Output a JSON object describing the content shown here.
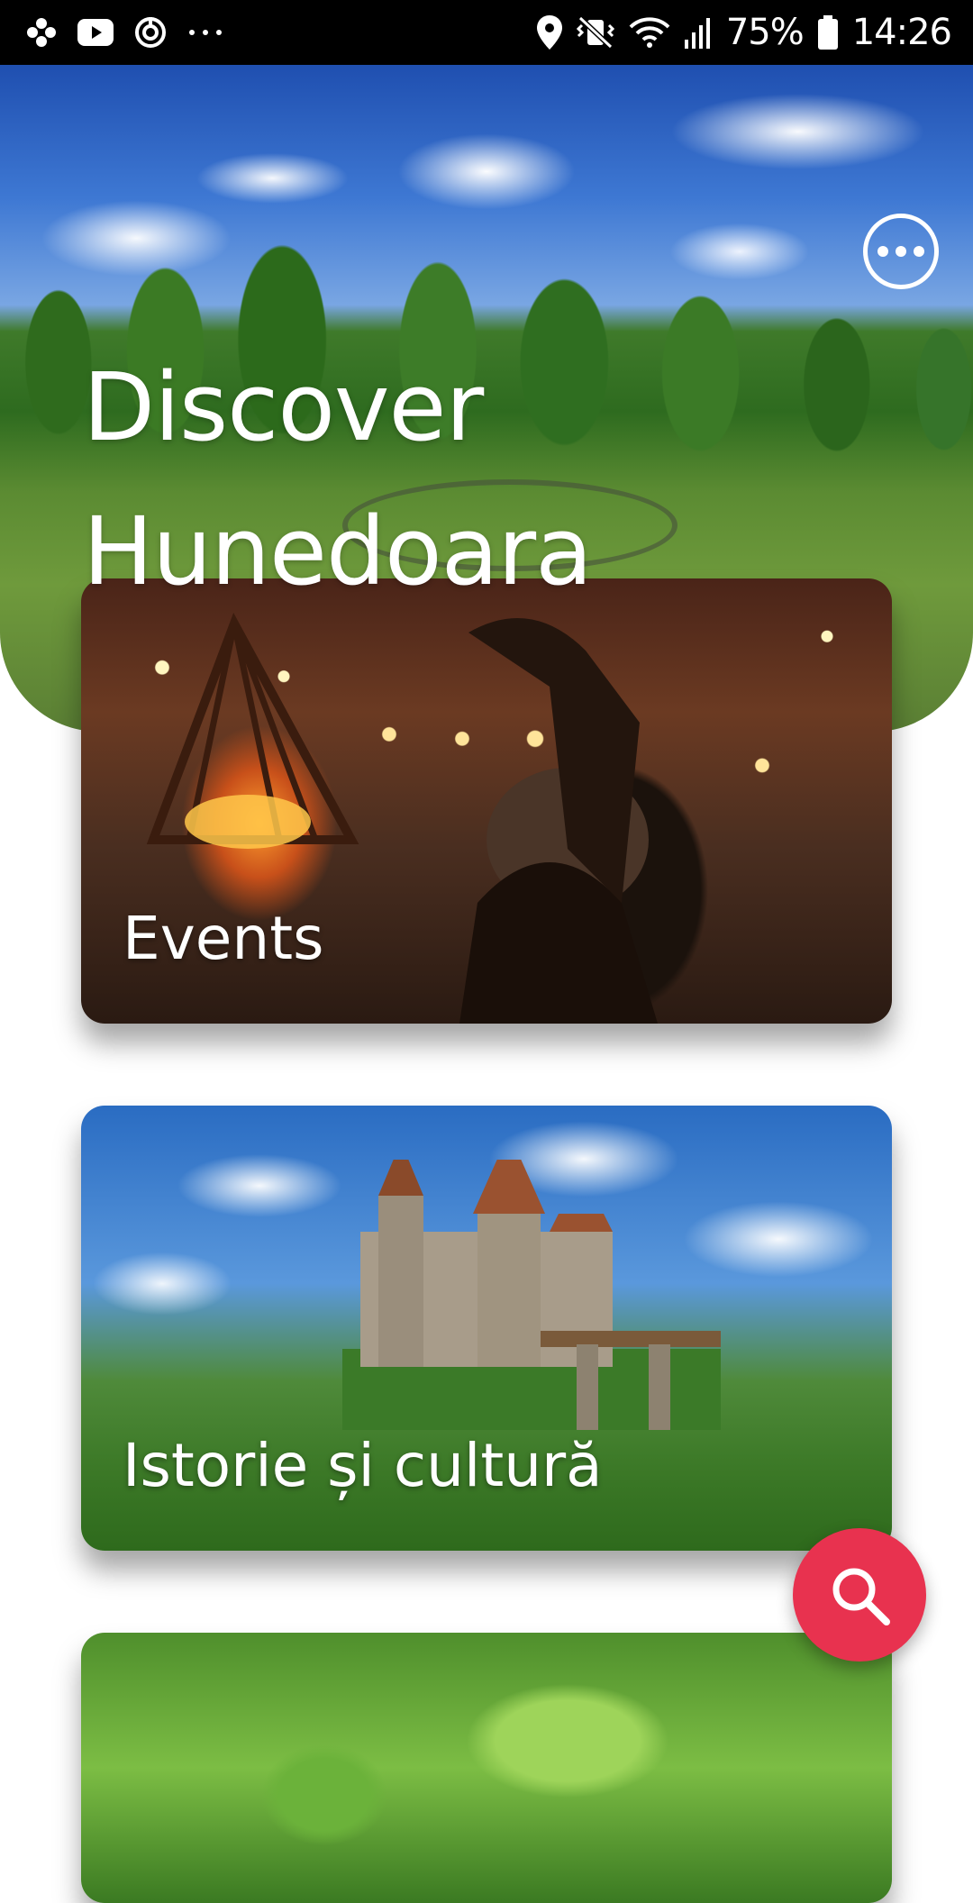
{
  "status_bar": {
    "battery": "75%",
    "time": "14:26",
    "left_icons": [
      "pinwheel-icon",
      "youtube-icon",
      "sync-icon",
      "more-dots-icon"
    ],
    "right_icons": [
      "location-icon",
      "vibrate-icon",
      "wifi-icon",
      "signal-icon",
      "battery-icon"
    ]
  },
  "hero": {
    "title_line1": "Discover",
    "title_line2": "Hunedoara",
    "more_icon": "more-options-icon"
  },
  "cards": [
    {
      "label": "Events"
    },
    {
      "label": "Istorie și cultură"
    },
    {
      "label": ""
    }
  ],
  "fab": {
    "icon": "search-icon",
    "color": "#e8324f"
  }
}
